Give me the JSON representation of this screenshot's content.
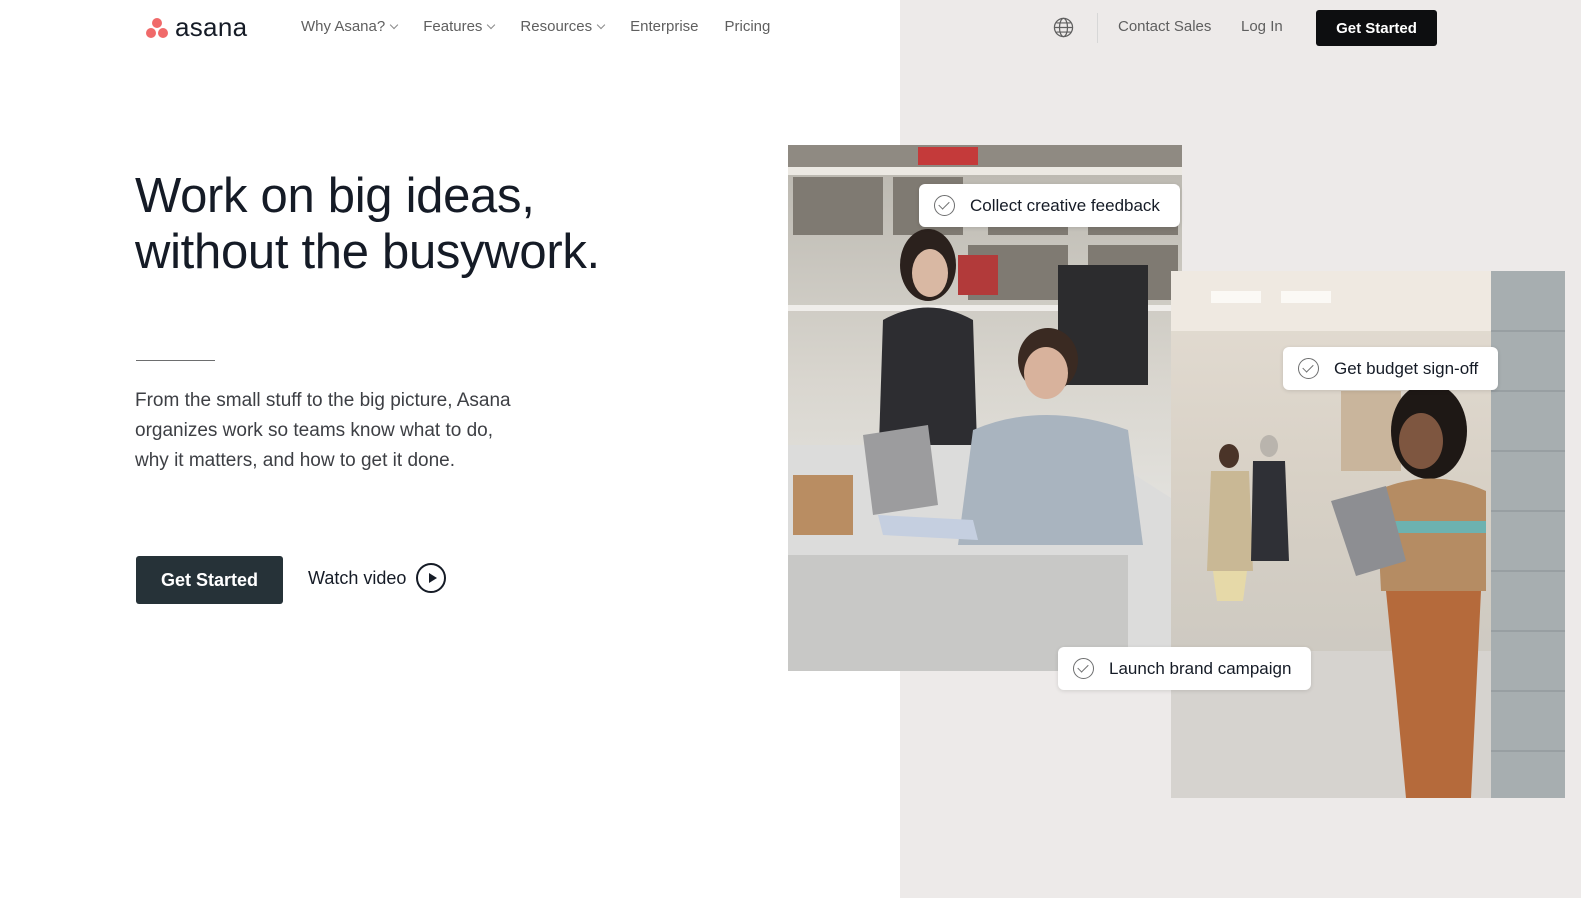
{
  "brand": {
    "logo_text": "asana",
    "logo_color": "#f06a6a"
  },
  "nav": {
    "items": [
      {
        "label": "Why Asana?",
        "has_dropdown": true
      },
      {
        "label": "Features",
        "has_dropdown": true
      },
      {
        "label": "Resources",
        "has_dropdown": true
      },
      {
        "label": "Enterprise",
        "has_dropdown": false
      },
      {
        "label": "Pricing",
        "has_dropdown": false
      }
    ],
    "globe_icon": "globe-icon",
    "contact_sales": "Contact Sales",
    "log_in": "Log In",
    "get_started": "Get Started"
  },
  "hero": {
    "headline_line1": "Work on big ideas,",
    "headline_line2": "without the busywork.",
    "sub_line1": "From the small stuff to the big picture, Asana",
    "sub_line2": "organizes work so teams know what to do,",
    "sub_line3": "why it matters, and how to get it done.",
    "cta": "Get Started",
    "watch_video": "Watch video",
    "play_icon": "play-circle-icon"
  },
  "tasks": [
    {
      "label": "Collect creative feedback"
    },
    {
      "label": "Get budget sign-off"
    },
    {
      "label": "Launch brand campaign"
    }
  ],
  "colors": {
    "right_panel": "#edeae9",
    "hero_button": "#263238",
    "nav_button": "#0d0e10"
  }
}
